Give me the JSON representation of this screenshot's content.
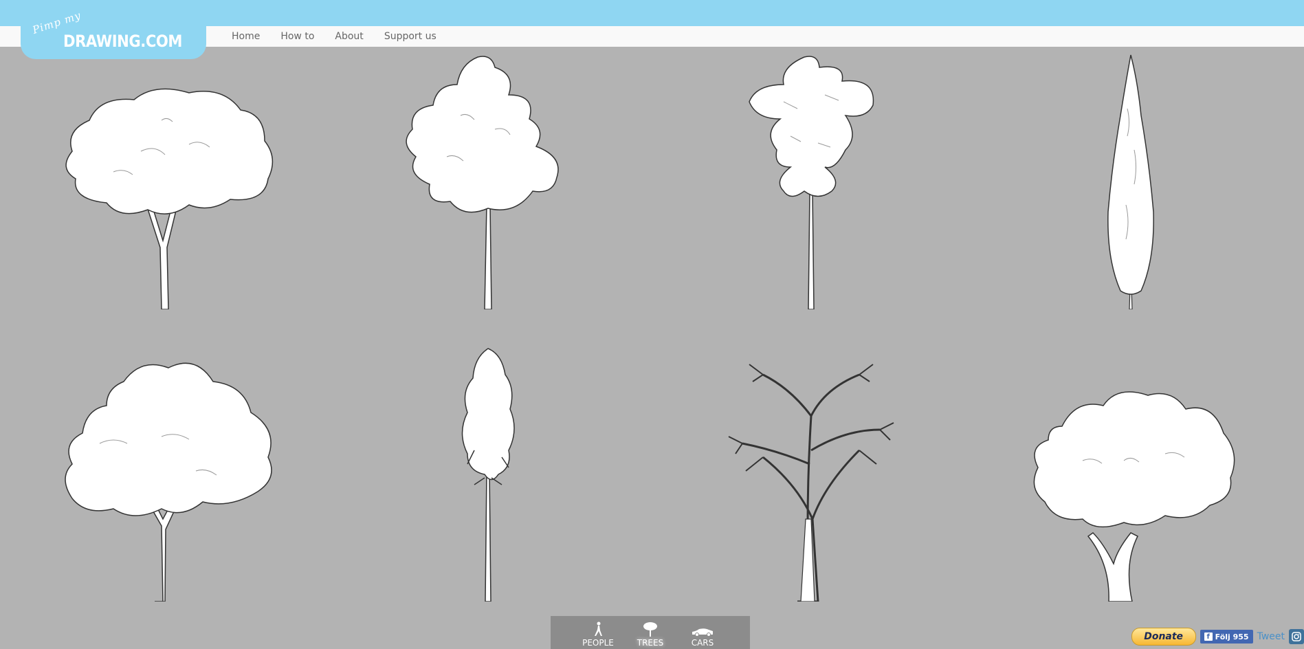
{
  "brand": {
    "logo_script": "Pimp my",
    "logo_main": "DRAWING.COM"
  },
  "nav": {
    "items": [
      {
        "label": "Home"
      },
      {
        "label": "How to"
      },
      {
        "label": "About"
      },
      {
        "label": "Support us"
      }
    ]
  },
  "gallery": {
    "category": "TREES",
    "items": [
      {
        "name": "broad-canopy-tree"
      },
      {
        "name": "irregular-leafy-tree"
      },
      {
        "name": "layered-tall-tree"
      },
      {
        "name": "cypress-tree"
      },
      {
        "name": "spreading-oak-tree"
      },
      {
        "name": "slender-pine-tree"
      },
      {
        "name": "bare-branch-tree"
      },
      {
        "name": "round-olive-tree"
      }
    ]
  },
  "category_picker": {
    "items": [
      {
        "label": "PEOPLE",
        "icon": "person-icon",
        "active": false
      },
      {
        "label": "TREES",
        "icon": "tree-icon",
        "active": true
      },
      {
        "label": "CARS",
        "icon": "car-icon",
        "active": false
      }
    ]
  },
  "social": {
    "donate_label": "Donate",
    "facebook_label": "Följ 955",
    "tweet_label": "Tweet"
  },
  "colors": {
    "background": "#b3b3b3",
    "header_blue": "#8fd6f2",
    "nav_bg": "#f9f9f9"
  }
}
